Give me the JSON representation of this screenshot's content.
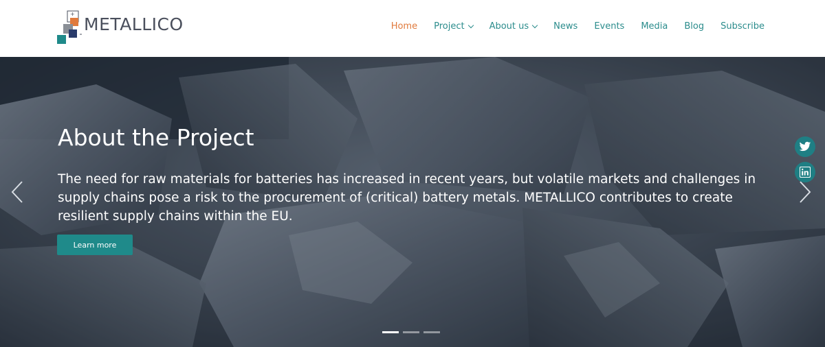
{
  "brand": {
    "name": "METALLICO"
  },
  "nav": {
    "items": [
      {
        "label": "Home",
        "active": true,
        "dropdown": false
      },
      {
        "label": "Project",
        "active": false,
        "dropdown": true
      },
      {
        "label": "About us",
        "active": false,
        "dropdown": true
      },
      {
        "label": "News",
        "active": false,
        "dropdown": false
      },
      {
        "label": "Events",
        "active": false,
        "dropdown": false
      },
      {
        "label": "Media",
        "active": false,
        "dropdown": false
      },
      {
        "label": "Blog",
        "active": false,
        "dropdown": false
      },
      {
        "label": "Subscribe",
        "active": false,
        "dropdown": false
      }
    ]
  },
  "hero": {
    "title": "About the Project",
    "text": "The need for raw materials for batteries has increased in recent years, but volatile markets and challenges in supply chains pose a risk to the procurement of (critical) battery metals. METALLICO contributes to create resilient supply chains within the EU.",
    "button_label": "Learn more",
    "slides_count": 3,
    "active_slide": 1
  },
  "social": [
    "twitter-icon",
    "linkedin-icon"
  ],
  "colors": {
    "accent": "#1f8a8a",
    "active_nav": "#e07a3c",
    "nav": "#2b8c8c"
  }
}
